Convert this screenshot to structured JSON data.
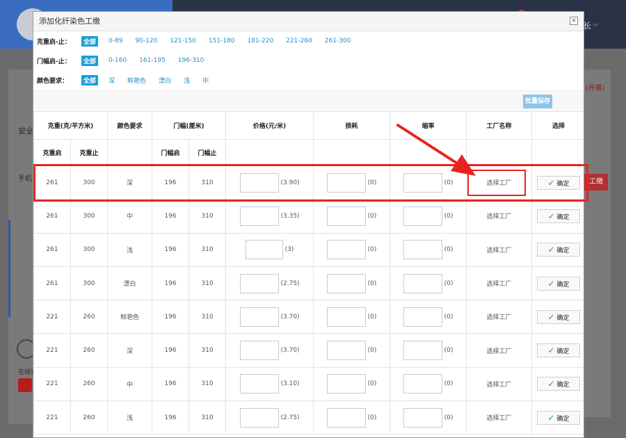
{
  "background": {
    "user_label": "长",
    "left_texts": [
      "安全",
      "手机",
      "在线客"
    ],
    "right_link": "(开票)",
    "right_button": "工缴"
  },
  "modal": {
    "title": "添加化纤染色工缴",
    "close_label": "×",
    "filters": [
      {
        "label": "克重启-止：",
        "options": [
          "全部",
          "0-89",
          "90-120",
          "121-150",
          "151-180",
          "181-220",
          "221-260",
          "261-300"
        ],
        "active": 0
      },
      {
        "label": "门幅启-止：",
        "options": [
          "全部",
          "0-160",
          "161-195",
          "196-310"
        ],
        "active": 0
      },
      {
        "label": "颜色要求：",
        "options": [
          "全部",
          "深",
          "鲜艳色",
          "漂白",
          "浅",
          "中"
        ],
        "active": 0
      }
    ],
    "batch_save": "批量保存",
    "table": {
      "headers": [
        "克重(克/平方米)",
        "颜色要求",
        "门幅(厘米)",
        "价格(元/米)",
        "损耗",
        "缩率",
        "工厂名称",
        "选择"
      ],
      "subheaders": [
        "克重启",
        "克重止",
        "门幅启",
        "门幅止"
      ],
      "factory_label": "选择工厂",
      "confirm_label": "确定",
      "rows": [
        {
          "w_start": "261",
          "w_end": "300",
          "color": "深",
          "d_start": "196",
          "d_end": "310",
          "price": "(3.90)",
          "loss": "(0)",
          "shrink": "(0)"
        },
        {
          "w_start": "261",
          "w_end": "300",
          "color": "中",
          "d_start": "196",
          "d_end": "310",
          "price": "(3.35)",
          "loss": "(0)",
          "shrink": "(0)"
        },
        {
          "w_start": "261",
          "w_end": "300",
          "color": "浅",
          "d_start": "196",
          "d_end": "310",
          "price": "(3)",
          "loss": "(0)",
          "shrink": "(0)"
        },
        {
          "w_start": "261",
          "w_end": "300",
          "color": "漂白",
          "d_start": "196",
          "d_end": "310",
          "price": "(2.75)",
          "loss": "(0)",
          "shrink": "(0)"
        },
        {
          "w_start": "221",
          "w_end": "260",
          "color": "鲜艳色",
          "d_start": "196",
          "d_end": "310",
          "price": "(3.70)",
          "loss": "(0)",
          "shrink": "(0)"
        },
        {
          "w_start": "221",
          "w_end": "260",
          "color": "深",
          "d_start": "196",
          "d_end": "310",
          "price": "(3.70)",
          "loss": "(0)",
          "shrink": "(0)"
        },
        {
          "w_start": "221",
          "w_end": "260",
          "color": "中",
          "d_start": "196",
          "d_end": "310",
          "price": "(3.10)",
          "loss": "(0)",
          "shrink": "(0)"
        },
        {
          "w_start": "221",
          "w_end": "260",
          "color": "浅",
          "d_start": "196",
          "d_end": "310",
          "price": "(2.75)",
          "loss": "(0)",
          "shrink": "(0)"
        }
      ]
    }
  },
  "colors": {
    "accent": "#1a9dd8",
    "link": "#1f8fd1",
    "highlight": "#e8231f",
    "batch_button": "#8ec5e8"
  }
}
